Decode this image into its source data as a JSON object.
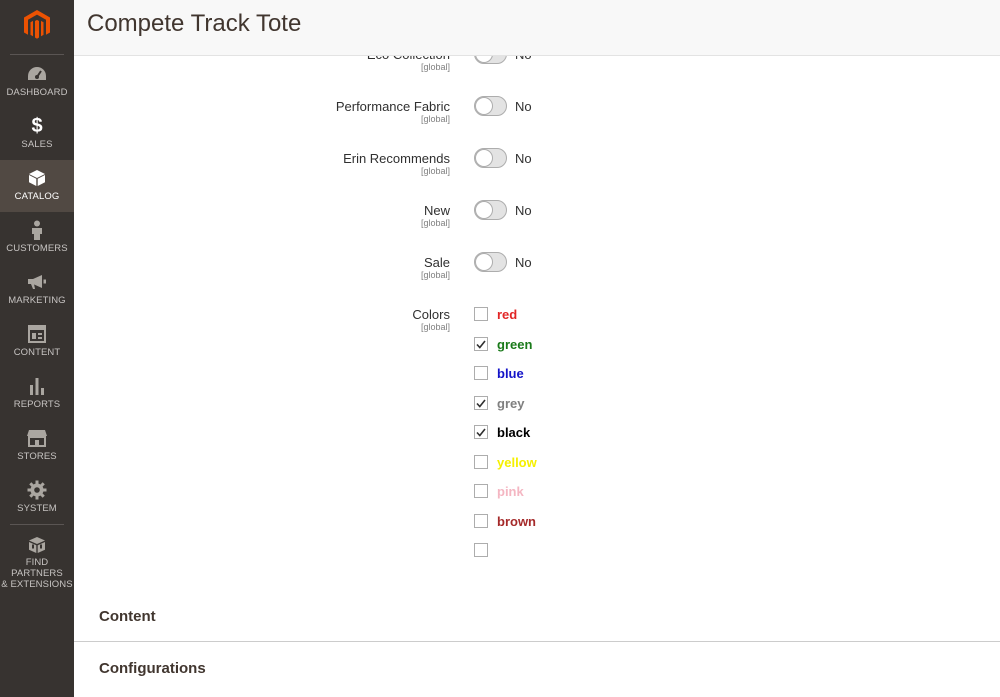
{
  "header": {
    "title": "Compete Track Tote"
  },
  "sidebar": {
    "items": [
      {
        "label": "DASHBOARD",
        "icon": "dashboard-icon"
      },
      {
        "label": "SALES",
        "icon": "dollar-icon"
      },
      {
        "label": "CATALOG",
        "icon": "box-icon"
      },
      {
        "label": "CUSTOMERS",
        "icon": "person-icon"
      },
      {
        "label": "MARKETING",
        "icon": "megaphone-icon"
      },
      {
        "label": "CONTENT",
        "icon": "layout-icon"
      },
      {
        "label": "REPORTS",
        "icon": "bar-chart-icon"
      },
      {
        "label": "STORES",
        "icon": "storefront-icon"
      },
      {
        "label": "SYSTEM",
        "icon": "gear-icon"
      },
      {
        "label_line1": "FIND PARTNERS",
        "label_line2": "& EXTENSIONS",
        "icon": "extensions-icon"
      }
    ]
  },
  "form": {
    "scope": "[global]",
    "no_label": "No",
    "toggles": [
      {
        "label": "Eco Collection",
        "value": "No"
      },
      {
        "label": "Performance Fabric",
        "value": "No"
      },
      {
        "label": "Erin Recommends",
        "value": "No"
      },
      {
        "label": "New",
        "value": "No"
      },
      {
        "label": "Sale",
        "value": "No"
      }
    ],
    "colors": {
      "label": "Colors",
      "options": [
        {
          "label": "red",
          "checked": false,
          "color": "#e22626"
        },
        {
          "label": "green",
          "checked": true,
          "color": "#1a7a1a"
        },
        {
          "label": "blue",
          "checked": false,
          "color": "#1414c8"
        },
        {
          "label": "grey",
          "checked": true,
          "color": "#808080"
        },
        {
          "label": "black",
          "checked": true,
          "color": "#000000"
        },
        {
          "label": "yellow",
          "checked": false,
          "color": "#f5f000"
        },
        {
          "label": "pink",
          "checked": false,
          "color": "#f4b6c2"
        },
        {
          "label": "brown",
          "checked": false,
          "color": "#a52a2a"
        },
        {
          "label": "",
          "checked": false,
          "color": "#333333"
        }
      ]
    }
  },
  "sections": [
    {
      "title": "Content"
    },
    {
      "title": "Configurations"
    }
  ],
  "colors": {
    "sidebar_bg": "#373330",
    "sidebar_active": "#514943",
    "brand_orange": "#eb5202"
  }
}
